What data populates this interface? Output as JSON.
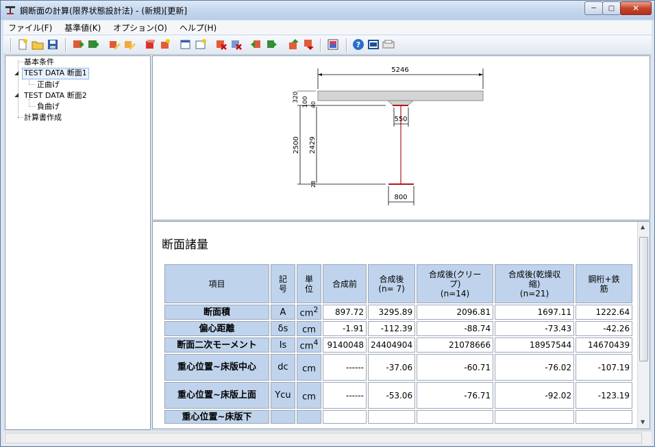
{
  "window": {
    "title": "鋼断面の計算(限界状態設計法) - (新規)[更新]"
  },
  "menu": [
    {
      "label": "ファイル(F)"
    },
    {
      "label": "基準値(K)"
    },
    {
      "label": "オプション(O)"
    },
    {
      "label": "ヘルプ(H)"
    }
  ],
  "toolbar_icons": [
    "new-file-icon",
    "open-folder-icon",
    "save-icon",
    "add-green-icon",
    "add-green2-icon",
    "edit-icon",
    "edit2-icon",
    "copy-red-icon",
    "copy2-icon",
    "window-icon",
    "window2-icon",
    "delete-icon",
    "delete2-icon",
    "prev-icon",
    "next-icon",
    "up-icon",
    "down-icon",
    "image-view-icon",
    "help-icon",
    "calc-icon",
    "print-icon"
  ],
  "tree": {
    "items": [
      {
        "label": "基本条件"
      },
      {
        "label": "TEST DATA 断面1"
      },
      {
        "label": "正曲げ"
      },
      {
        "label": "TEST DATA 断面2"
      },
      {
        "label": "負曲げ"
      },
      {
        "label": "計算書作成"
      }
    ]
  },
  "diagram": {
    "dims": {
      "slab_width": "5246",
      "slab_thick": "320",
      "haunch": "100",
      "top_flange_t": "40",
      "total_height": "2500",
      "web_height": "2429",
      "bottom_flange_t": "28",
      "top_flange_w": "550",
      "bottom_flange_w": "800"
    },
    "colors": {
      "slab": "#d4d4d4",
      "steel": "#b01818"
    }
  },
  "results": {
    "title": "断面諸量",
    "headers": [
      "項目",
      "記号",
      "単位",
      "合成前",
      "合成後\n(n= 7)",
      "合成後(クリープ)\n(n=14)",
      "合成後(乾燥収縮)\n(n=21)",
      "鋼桁+鉄筋"
    ],
    "rows": [
      {
        "item": "断面積",
        "sym": "A",
        "unit": "cm",
        "sup": "2",
        "v": [
          "897.72",
          "3295.89",
          "2096.81",
          "1697.11",
          "1222.64"
        ]
      },
      {
        "item": "偏心距離",
        "sym": "δs",
        "unit": "cm",
        "sup": "",
        "v": [
          "-1.91",
          "-112.39",
          "-88.74",
          "-73.43",
          "-42.26"
        ]
      },
      {
        "item": "断面二次モーメント",
        "sym": "Is",
        "unit": "cm",
        "sup": "4",
        "v": [
          "9140048",
          "24404904",
          "21078666",
          "18957544",
          "14670439"
        ]
      },
      {
        "item": "重心位置~床版中心",
        "sym": "dc",
        "unit": "cm",
        "sup": "",
        "v": [
          "------",
          "-37.06",
          "-60.71",
          "-76.02",
          "-107.19"
        ]
      },
      {
        "item": "重心位置~床版上面",
        "sym": "Ycu",
        "unit": "cm",
        "sup": "",
        "v": [
          "------",
          "-53.06",
          "-76.71",
          "-92.02",
          "-123.19"
        ]
      },
      {
        "item": "重心位置~床版下",
        "sym": "",
        "unit": "",
        "sup": "",
        "v": [
          "",
          "",
          "",
          "",
          ""
        ]
      }
    ]
  }
}
